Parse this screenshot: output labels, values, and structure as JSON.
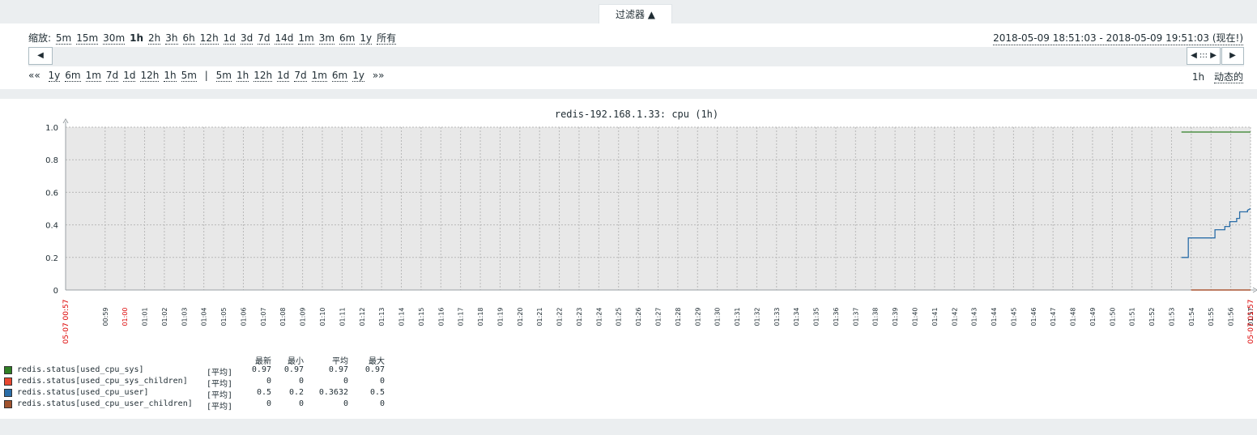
{
  "filter": {
    "tab_label": "过滤器 ▲"
  },
  "zoom": {
    "label": "缩放:",
    "options": [
      "5m",
      "15m",
      "30m",
      "1h",
      "2h",
      "3h",
      "6h",
      "12h",
      "1d",
      "3d",
      "7d",
      "14d",
      "1m",
      "3m",
      "6m",
      "1y",
      "所有"
    ],
    "active": "1h"
  },
  "range_text": "2018-05-09 18:51:03 - 2018-05-09 19:51:03 (现在!)",
  "scroll": {
    "left_btn": "◀",
    "right_group": "◀ ::: ▶",
    "right_btn": "▶"
  },
  "nav": {
    "back_prefix": "««",
    "back": [
      "1y",
      "6m",
      "1m",
      "7d",
      "1d",
      "12h",
      "1h",
      "5m"
    ],
    "separator": "|",
    "forward": [
      "5m",
      "1h",
      "12h",
      "1d",
      "7d",
      "1m",
      "6m",
      "1y"
    ],
    "forward_suffix": "»»",
    "period": "1h",
    "dynamic": "动态的"
  },
  "chart_data": {
    "type": "line",
    "title": "redis-192.168.1.33: cpu (1h)",
    "ylim": [
      0,
      1.0
    ],
    "yticks": [
      "1.0",
      "0.8",
      "0.6",
      "0.4",
      "0.2",
      "0"
    ],
    "xtick_labels": [
      "00:59",
      "01:00",
      "01:01",
      "01:02",
      "01:03",
      "01:04",
      "01:05",
      "01:06",
      "01:07",
      "01:08",
      "01:09",
      "01:10",
      "01:11",
      "01:12",
      "01:13",
      "01:14",
      "01:15",
      "01:16",
      "01:17",
      "01:18",
      "01:19",
      "01:20",
      "01:21",
      "01:22",
      "01:23",
      "01:24",
      "01:25",
      "01:26",
      "01:27",
      "01:28",
      "01:29",
      "01:30",
      "01:31",
      "01:32",
      "01:33",
      "01:34",
      "01:35",
      "01:36",
      "01:37",
      "01:38",
      "01:39",
      "01:40",
      "01:41",
      "01:42",
      "01:43",
      "01:44",
      "01:45",
      "01:46",
      "01:47",
      "01:48",
      "01:49",
      "01:50",
      "01:51",
      "01:52",
      "01:53",
      "01:54",
      "01:55",
      "01:56",
      "01:57"
    ],
    "x_start_label": "05-07 00:57",
    "x_end_label": "05-07 01:57",
    "x_range_minutes": [
      0,
      60
    ],
    "grid": true,
    "legend_headers": [
      "最新",
      "最小",
      "平均",
      "最大"
    ],
    "series": [
      {
        "name": "redis.status[used_cpu_sys]",
        "func": "[平均]",
        "color": "#2f7f24",
        "stats": [
          "0.97",
          "0.97",
          "0.97",
          "0.97"
        ],
        "points": [
          [
            56.5,
            0.97
          ],
          [
            60,
            0.97
          ]
        ]
      },
      {
        "name": "redis.status[used_cpu_sys_children]",
        "func": "[平均]",
        "color": "#e8472f",
        "stats": [
          "0",
          "0",
          "0",
          "0"
        ],
        "points": [
          [
            57.0,
            0.0
          ],
          [
            60,
            0.0
          ]
        ]
      },
      {
        "name": "redis.status[used_cpu_user]",
        "func": "[平均]",
        "color": "#2b6ea8",
        "stats": [
          "0.5",
          "0.2",
          "0.3632",
          "0.5"
        ],
        "points": [
          [
            56.5,
            0.2
          ],
          [
            56.85,
            0.2
          ],
          [
            56.85,
            0.32
          ],
          [
            58.2,
            0.32
          ],
          [
            58.2,
            0.37
          ],
          [
            58.7,
            0.37
          ],
          [
            58.7,
            0.39
          ],
          [
            58.95,
            0.39
          ],
          [
            58.95,
            0.42
          ],
          [
            59.3,
            0.42
          ],
          [
            59.3,
            0.44
          ],
          [
            59.45,
            0.44
          ],
          [
            59.45,
            0.48
          ],
          [
            59.85,
            0.48
          ],
          [
            59.85,
            0.49
          ],
          [
            60,
            0.5
          ]
        ]
      },
      {
        "name": "redis.status[used_cpu_user_children]",
        "func": "[平均]",
        "color": "#a0522d",
        "stats": [
          "0",
          "0",
          "0",
          "0"
        ],
        "points": [
          [
            57.0,
            0.0
          ],
          [
            60,
            0.0
          ]
        ]
      }
    ]
  }
}
